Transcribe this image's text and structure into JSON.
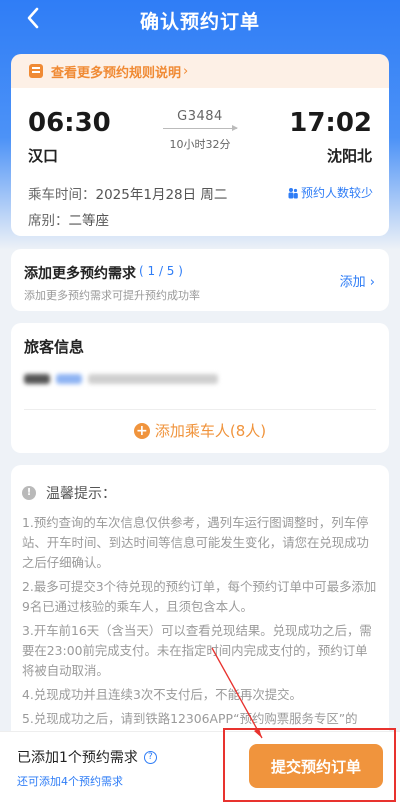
{
  "nav": {
    "title": "确认预约订单",
    "back_icon": "chevron-left-icon"
  },
  "rules_banner": {
    "text": "查看更多预约规则说明",
    "chevron": "›"
  },
  "train": {
    "departure_time": "06:30",
    "arrival_time": "17:02",
    "departure_station": "汉口",
    "arrival_station": "沈阳北",
    "train_no": "G3484",
    "duration": "10小时32分",
    "ride_time_label": "乘车时间：",
    "ride_time_value": "2025年1月28日 周二",
    "seat_label": "席别：",
    "seat_value": "二等座",
    "few_pax_text": "预约人数较少"
  },
  "needs": {
    "title": "添加更多预约需求",
    "count": "( 1 / 5 )",
    "subtitle": "添加更多预约需求可提升预约成功率",
    "add_label": "添加",
    "add_chevron": "›"
  },
  "passengers": {
    "title": "旅客信息",
    "add_label": "添加乘车人(8人)"
  },
  "tips": {
    "title": "温馨提示：",
    "items": [
      "1.预约查询的车次信息仅供参考，遇列车运行图调整时，列车停站、开车时间、到达时间等信息可能发生变化，请您在兑现成功之后仔细确认。",
      "2.最多可提交3个待兑现的预约订单，每个预约订单中可最多添加9名已通过核验的乘车人，且须包含本人。",
      "3.开车前16天（含当天）可以查看兑现结果。兑现成功之后，需要在23:00前完成支付。未在指定时间内完成支付的，预约订单将被自动取消。",
      "4.兑现成功并且连续3次不支付后，不能再次提交。",
      "5.兑现成功之后，请到铁路12306APP“预约购票服务专区”的"
    ]
  },
  "bottom": {
    "added_text": "已添加1个预约需求",
    "remaining_text": "还可添加4个预约需求",
    "submit_label": "提交预约订单"
  },
  "colors": {
    "primary_blue": "#2f7df6",
    "accent_orange": "#f0943d",
    "annotation_red": "#e8322e"
  }
}
